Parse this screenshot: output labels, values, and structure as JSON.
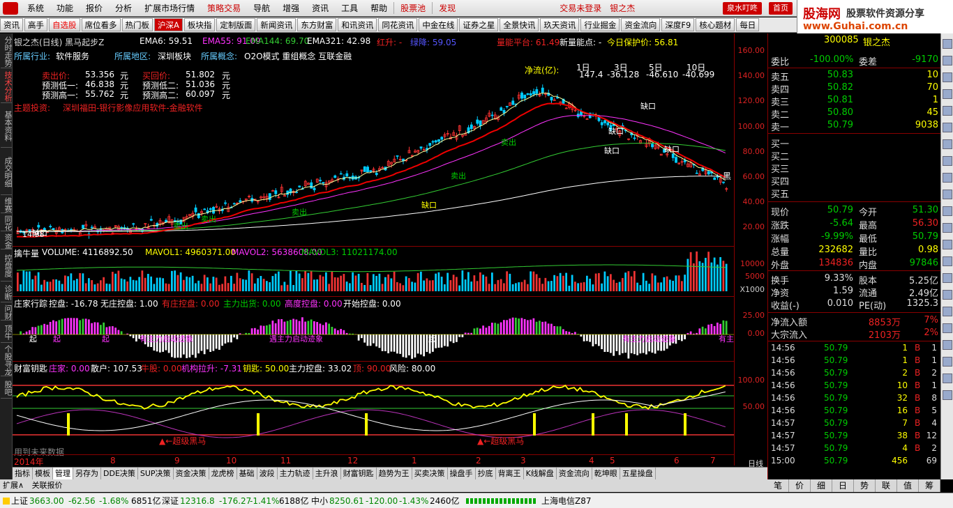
{
  "menu": {
    "items": [
      "系统",
      "功能",
      "报价",
      "分析",
      "扩展市场行情",
      "策略交易",
      "导航",
      "增强",
      "资讯",
      "工具",
      "帮助",
      "股票池",
      "发现"
    ],
    "center": "交易未登录",
    "user": "银之杰",
    "btn1": "泉水叮咚",
    "btn2": "首页"
  },
  "brand": {
    "name": "股海网",
    "slogan": "股票软件资源分享",
    "url": "www.Guhai.com.cn"
  },
  "toolbar": [
    "资讯",
    "高手",
    "自选股",
    "席位看多",
    "热门板",
    "沪深A",
    "板块指",
    "定制版面",
    "新闻资讯",
    "东方财富",
    "和讯资讯",
    "同花资讯",
    "中金在线",
    "证券之星",
    "全景快讯",
    "玖天资讯",
    "行业掘金",
    "资金流向",
    "深度F9",
    "核心题材",
    "每日"
  ],
  "left_tabs": [
    "分时走势",
    "技术分析",
    "基本资料",
    "成交明细",
    "维赛",
    "同花",
    "资金",
    "控盘度",
    "诊断",
    "问财",
    "顶牛",
    "个股寻龙",
    "股吧"
  ],
  "kline": {
    "title": "银之杰(日线) 黑马起步Z",
    "ema": [
      {
        "label": "EMA6: 59.51",
        "color": "#fff"
      },
      {
        "label": "EMA55: 91.09",
        "color": "#f3f"
      },
      {
        "label": "EMA144: 69.70",
        "color": "#0c0"
      },
      {
        "label": "EMA321: 42.98",
        "color": "#fff"
      }
    ],
    "redline": "红升: -",
    "greenline": "绿降: 59.05",
    "energy": "量能平台: 61.49",
    "newenergy": "新量能点: -",
    "today": "今日保护价: 56.81",
    "industry": "所属行业:",
    "industry_v": "软件服务",
    "region": "所属地区:",
    "region_v": "深圳板块",
    "concept": "所属概念:",
    "concept_v": "O2O模式 重组概念 互联金融",
    "sell_price": "卖出价:",
    "sell_price_v": "53.356",
    "buy_price": "买回价:",
    "buy_price_v": "51.802",
    "unit": "元",
    "low1": "预测低一:",
    "low1_v": "46.838",
    "low2": "预测低二:",
    "low2_v": "51.036",
    "high1": "预测高一:",
    "high1_v": "55.762",
    "high2": "预测高二:",
    "high2_v": "60.097",
    "theme": "主题投资:",
    "theme_v": "深圳福田-银行影像应用软件-金融软件",
    "netflow": "净流(亿):",
    "nf_labels": [
      "1日",
      "3日",
      "5日",
      "10日"
    ],
    "nf_values": [
      "147.4",
      "-36.128",
      "-46.610",
      "-40.699"
    ],
    "low_mark": "14.98",
    "hi_mark": "黑",
    "signals": [
      "卖出",
      "卖出",
      "缺口",
      "缺口",
      "缺口",
      "卖出",
      "卖出",
      "缺口",
      "缺口",
      "缺口",
      "卖出"
    ],
    "yaxis": [
      "160.00",
      "140.00",
      "120.00",
      "100.00",
      "80.00",
      "60.00",
      "40.00",
      "20.00"
    ]
  },
  "volume": {
    "title": "擒牛量",
    "vol": "VOLUME: 4116892.50",
    "m1": "MAVOL1: 4960371.00",
    "m2": "MAVOL2: 5638608.00",
    "m3": "MAVOL3: 11021174.00",
    "yaxis": [
      "10000",
      "5000"
    ],
    "unit": "X1000"
  },
  "control": {
    "title": "庄家行踪",
    "kp": "控盘: -16.78",
    "wz": "无庄控盘: 1.00",
    "yz": "有庄控盘: 0.00",
    "zl": "主力出货: 0.00",
    "gd": "高度控盘: 0.00",
    "ks": "开始控盘: 0.00",
    "yaxis": [
      "25.00",
      "0.00"
    ],
    "labels": [
      "起",
      "起",
      "有主力启动迹象",
      "起",
      "起",
      "遇主力启动迹象",
      "有主力启动迹象",
      "有主"
    ]
  },
  "fortune": {
    "title": "财富钥匙",
    "zj": "庄家: 0.00",
    "sh": "散户: 107.53",
    "ng": "牛股: 0.00",
    "jg": "机构拉升: -7.31",
    "ys": "钥匙: 50.00",
    "zk": "主力控盘: 33.02",
    "top": "顶: 90.00",
    "risk": "风险: 80.00",
    "yaxis": [
      "100.00",
      "50.00"
    ],
    "marks": [
      "▲←超级黑马",
      "▲←超级黑马"
    ],
    "future": "用到未来数据"
  },
  "xaxis": {
    "year": "2014年",
    "months": [
      "8",
      "9",
      "10",
      "11",
      "12",
      "1",
      "2",
      "3",
      "4",
      "5",
      "6",
      "7"
    ],
    "period": "日线"
  },
  "quote": {
    "code": "300085",
    "name": "银之杰",
    "wb_label": "委比",
    "wb": "-100.00%",
    "wc_label": "委差",
    "wc": "-9170",
    "asks": [
      {
        "l": "卖五",
        "p": "50.83",
        "v": "10"
      },
      {
        "l": "卖四",
        "p": "50.82",
        "v": "70"
      },
      {
        "l": "卖三",
        "p": "50.81",
        "v": "1"
      },
      {
        "l": "卖二",
        "p": "50.80",
        "v": "45"
      },
      {
        "l": "卖一",
        "p": "50.79",
        "v": "9038"
      }
    ],
    "bids": [
      "买一",
      "买二",
      "买三",
      "买四",
      "买五"
    ],
    "stats": [
      {
        "a": "现价",
        "b": "50.79",
        "bc": "#0c0",
        "c": "今开",
        "d": "51.30",
        "dc": "#0c0"
      },
      {
        "a": "涨跌",
        "b": "-5.64",
        "bc": "#0c0",
        "c": "最高",
        "d": "56.30",
        "dc": "#e22"
      },
      {
        "a": "涨幅",
        "b": "-9.99%",
        "bc": "#0c0",
        "c": "最低",
        "d": "50.79",
        "dc": "#0c0"
      },
      {
        "a": "总量",
        "b": "232682",
        "bc": "#ff0",
        "c": "量比",
        "d": "0.98",
        "dc": "#ff0"
      },
      {
        "a": "外盘",
        "b": "134836",
        "bc": "#e22",
        "c": "内盘",
        "d": "97846",
        "dc": "#0c0"
      }
    ],
    "stats2": [
      {
        "a": "换手",
        "b": "9.33%",
        "bc": "#ddd",
        "c": "股本",
        "d": "5.25亿",
        "dc": "#ddd"
      },
      {
        "a": "净资",
        "b": "1.59",
        "bc": "#ddd",
        "c": "流通",
        "d": "2.49亿",
        "dc": "#ddd"
      },
      {
        "a": "收益(-)",
        "b": "0.010",
        "bc": "#ddd",
        "c": "PE(动)",
        "d": "1325.3",
        "dc": "#ddd"
      }
    ],
    "flows": [
      {
        "a": "净流入额",
        "b": "8853万",
        "c": "7%"
      },
      {
        "a": "大宗流入",
        "b": "2103万",
        "c": "2%"
      }
    ],
    "ticks": [
      {
        "t": "14:56",
        "p": "50.79",
        "v": "1",
        "s": "B",
        "n": "1"
      },
      {
        "t": "14:56",
        "p": "50.79",
        "v": "1",
        "s": "B",
        "n": "1"
      },
      {
        "t": "14:56",
        "p": "50.79",
        "v": "2",
        "s": "B",
        "n": "2"
      },
      {
        "t": "14:56",
        "p": "50.79",
        "v": "10",
        "s": "B",
        "n": "1"
      },
      {
        "t": "14:56",
        "p": "50.79",
        "v": "32",
        "s": "B",
        "n": "8"
      },
      {
        "t": "14:56",
        "p": "50.79",
        "v": "16",
        "s": "B",
        "n": "5"
      },
      {
        "t": "14:57",
        "p": "50.79",
        "v": "7",
        "s": "B",
        "n": "4"
      },
      {
        "t": "14:57",
        "p": "50.79",
        "v": "38",
        "s": "B",
        "n": "12"
      },
      {
        "t": "14:57",
        "p": "50.79",
        "v": "4",
        "s": "B",
        "n": "2"
      },
      {
        "t": "15:00",
        "p": "50.79",
        "v": "456",
        "s": "",
        "n": "69"
      }
    ]
  },
  "bottom_tabs": [
    "指标",
    "模板",
    "管理",
    "另存为",
    "DDE决策",
    "SUP决策",
    "资金决策",
    "龙虎榜",
    "基础",
    "波段",
    "主力轨迹",
    "主升浪",
    "财富钥匙",
    "趋势为王",
    "买卖决策",
    "操盘手",
    "抄底",
    "背离王",
    "K线解盘",
    "资金流向",
    "乾坤眼",
    "五星操盘"
  ],
  "quote_tabs": [
    "笔",
    "价",
    "细",
    "日",
    "势",
    "联",
    "值",
    "筹"
  ],
  "ext": {
    "a": "扩展∧",
    "b": "关联报价"
  },
  "status": {
    "sh_label": "上证",
    "sh": "3663.00",
    "sh_chg": "-62.56",
    "sh_pct": "-1.68%",
    "sh_amt": "6851亿",
    "sz_label": "深证",
    "sz": "12316.8",
    "sz_chg": "-176.27",
    "sz_pct": "-1.41%",
    "sz_amt": "6188亿",
    "zx_label": "中小",
    "zx": "8250.61",
    "zx_chg": "-120.00",
    "zx_pct": "-1.43%",
    "zx_amt": "2460亿",
    "server": "上海电信Z87"
  }
}
